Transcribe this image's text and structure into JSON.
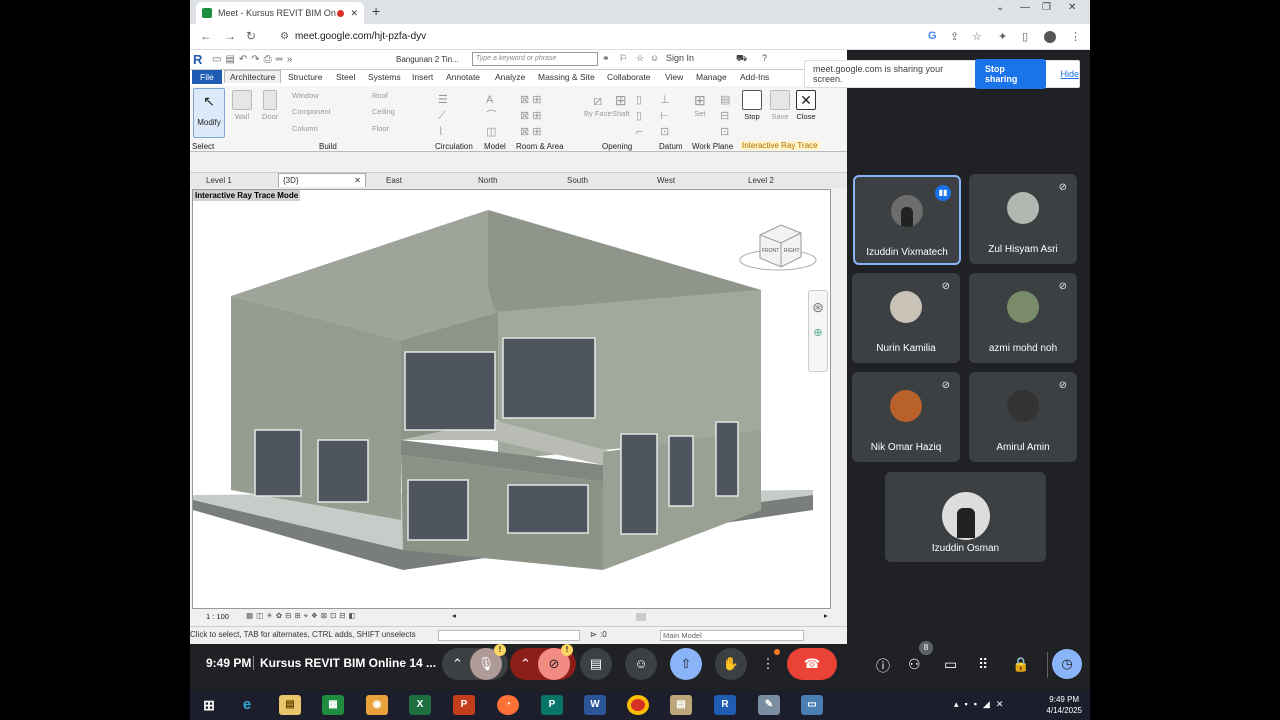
{
  "browser": {
    "tab_title": "Meet - Kursus REVIT BIM On",
    "new_tab": "+",
    "url": "meet.google.com/hjt-pzfa-dyv",
    "win_min": "—",
    "win_max": "❐",
    "win_close": "✕"
  },
  "sharing": {
    "message": "meet.google.com is sharing your screen.",
    "stop_label": "Stop sharing",
    "hide_label": "Hide"
  },
  "revit": {
    "document": "Bangunan 2 Tin...",
    "search_placeholder": "Type a keyword or phrase",
    "sign_in": "Sign In",
    "menus": [
      "File",
      "Architecture",
      "Structure",
      "Steel",
      "Systems",
      "Insert",
      "Annotate",
      "Analyze",
      "Massing & Site",
      "Collaborate",
      "View",
      "Manage",
      "Add-Ins"
    ],
    "ribbon": {
      "modify": "Modify",
      "wall": "Wall",
      "door": "Door",
      "window": "Window",
      "component": "Component",
      "column": "Column",
      "roof": "Roof",
      "ceiling": "Ceiling",
      "floor": "Floor",
      "by_face": "By Face",
      "shaft": "Shaft",
      "set": "Set",
      "stop": "Stop",
      "save": "Save",
      "close": "Close"
    },
    "panels": {
      "select": "Select",
      "build": "Build",
      "circulation": "Circulation",
      "model": "Model",
      "room_area": "Room & Area",
      "opening": "Opening",
      "datum": "Datum",
      "work_plane": "Work Plane",
      "interactive_ray_trace": "Interactive Ray Trace"
    },
    "view_tabs": [
      "Level 1",
      "{3D}",
      "East",
      "North",
      "South",
      "West",
      "Level 2"
    ],
    "viewport_mode": "Interactive Ray Trace Mode",
    "view_cube": {
      "front": "FRONT",
      "right": "RIGHT"
    },
    "scale": "1 : 100",
    "status": "Click to select, TAB for alternates, CTRL adds, SHIFT unselects",
    "selection_count": ":0",
    "main_model": "Main Model"
  },
  "participants": [
    {
      "name": "Izuddin Vixmatech",
      "speaking": true
    },
    {
      "name": "Zul Hisyam Asri",
      "muted": true
    },
    {
      "name": "Nurin Kamilia",
      "muted": true
    },
    {
      "name": "azmi mohd noh",
      "muted": true
    },
    {
      "name": "Nik Omar Haziq",
      "muted": true
    },
    {
      "name": "Amirul Amin",
      "muted": true
    },
    {
      "name": "Izuddin Osman"
    }
  ],
  "meet": {
    "time": "9:49 PM",
    "meeting_title": "Kursus REVIT BIM Online 14 ...",
    "participant_count": "8",
    "warn_mark": "!"
  },
  "taskbar": {
    "clock_time": "9:49 PM",
    "clock_date": "4/14/2025"
  },
  "colors": {
    "accent": "#1a73e8",
    "end_call": "#ea4335",
    "meet_bg": "#202124",
    "revit_blue": "#1f5cb3"
  }
}
